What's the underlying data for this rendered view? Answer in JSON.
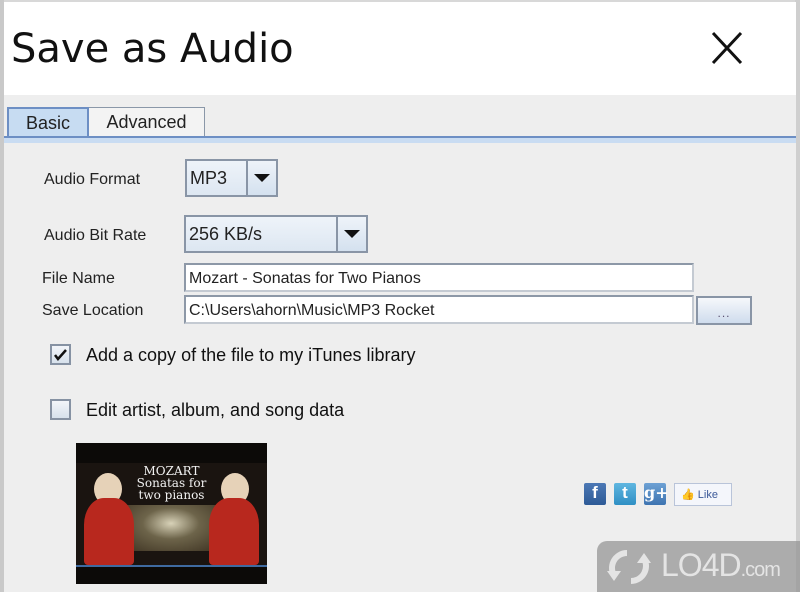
{
  "dialog": {
    "title": "Save as Audio",
    "close_icon": "close-x-icon"
  },
  "tabs": [
    {
      "label": "Basic",
      "selected": true
    },
    {
      "label": "Advanced",
      "selected": false
    }
  ],
  "form": {
    "audio_format": {
      "label": "Audio Format",
      "value": "MP3"
    },
    "audio_bit_rate": {
      "label": "Audio Bit Rate",
      "value": "256 KB/s"
    },
    "file_name": {
      "label": "File Name",
      "value": "Mozart - Sonatas for Two Pianos"
    },
    "save_location": {
      "label": "Save Location",
      "value": "C:\\Users\\ahorn\\Music\\MP3 Rocket"
    },
    "browse_label": "..."
  },
  "checkboxes": [
    {
      "label": "Add a copy of the file to my iTunes library",
      "checked": true
    },
    {
      "label": "Edit artist, album, and song data",
      "checked": false
    }
  ],
  "album_art": {
    "line1": "MOZART",
    "line2": "Sonatas for",
    "line3": "two pianos"
  },
  "social": {
    "facebook": "f",
    "twitter": "t",
    "google_plus": "g+",
    "like_label": "Like"
  },
  "watermark": {
    "text": "LO4D",
    "suffix": ".com"
  }
}
